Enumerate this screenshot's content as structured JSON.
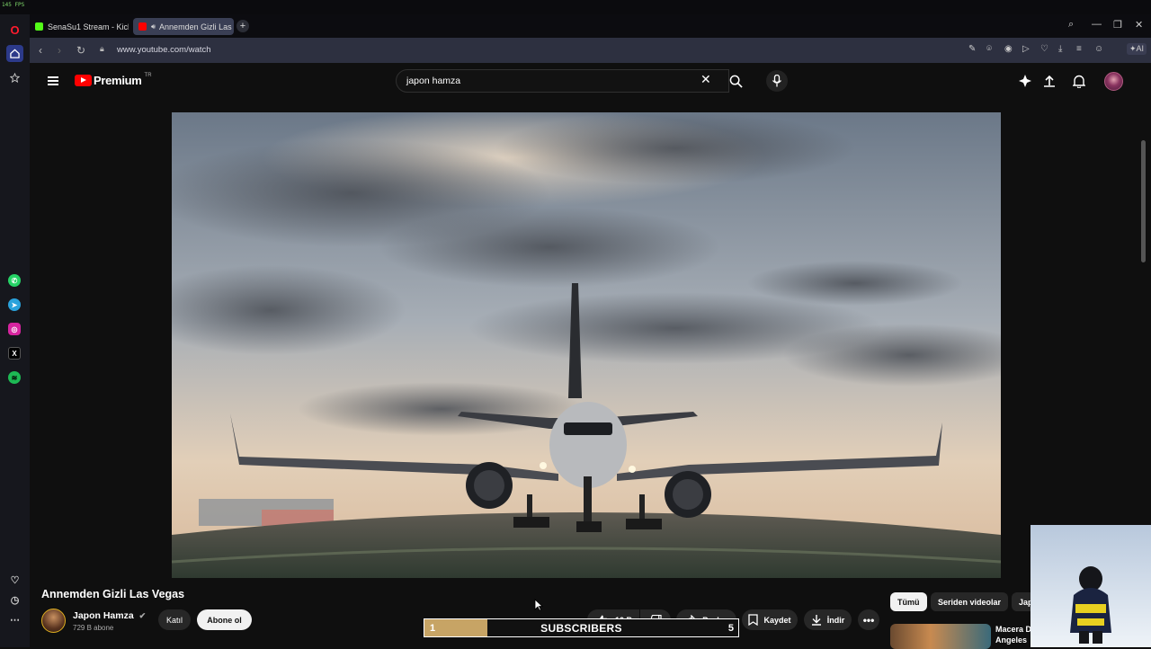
{
  "os": {
    "fps_overlay": "145 FPS"
  },
  "tabs": [
    {
      "label": "SenaSu1 Stream - Kick Da",
      "favicon_color": "#53fc18"
    },
    {
      "label": "Annemden Gizli Las Ve",
      "favicon_color": "#ff0000",
      "active": true
    }
  ],
  "address_bar": {
    "url": "www.youtube.com/watch",
    "ai_label": "AI"
  },
  "youtube": {
    "logo_text": "Premium",
    "region": "TR",
    "search_value": "japon hamza"
  },
  "video": {
    "title": "Annemden Gizli Las Vegas",
    "channel_name": "Japon Hamza",
    "subscribers": "729 B abone",
    "join_label": "Katıl",
    "subscribe_label": "Abone ol",
    "likes": "10 B",
    "share_label": "Paylaş",
    "save_label": "Kaydet",
    "download_label": "İndir"
  },
  "chips": [
    "Tümü",
    "Seriden videolar",
    "Jap"
  ],
  "recommended": {
    "title_line1": "Macera D",
    "title_line2": "Angeles"
  },
  "subscriber_goal": {
    "label": "SUBSCRIBERS",
    "current": "1",
    "target": "5",
    "progress": 0.2
  },
  "colors": {
    "accent": "#ff0000",
    "goal_fill": "#c7a465",
    "sidebar_opera": "#ff1b2d"
  }
}
